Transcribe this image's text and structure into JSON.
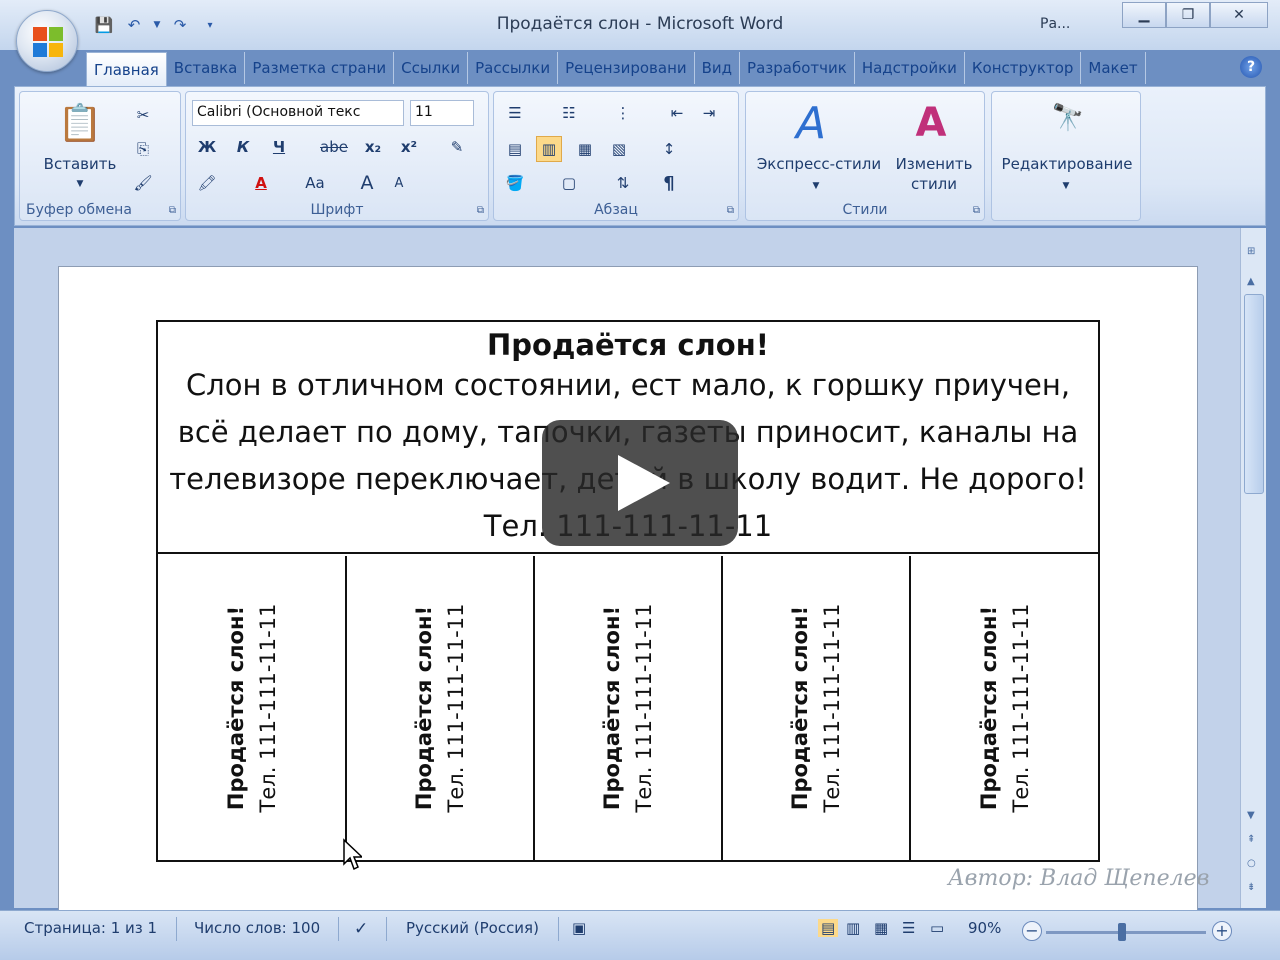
{
  "window": {
    "title": "Продаётся слон - Microsoft Word",
    "context": "Ра..."
  },
  "tabs": [
    "Главная",
    "Вставка",
    "Разметка страни",
    "Ссылки",
    "Рассылки",
    "Рецензировани",
    "Вид",
    "Разработчик",
    "Надстройки",
    "Конструктор",
    "Макет"
  ],
  "ribbon": {
    "clipboard": {
      "paste_label": "Вставить",
      "group_label": "Буфер обмена"
    },
    "font": {
      "font_name": "Calibri (Основной текс",
      "font_size": "11",
      "group_label": "Шрифт",
      "bold": "Ж",
      "italic": "К",
      "underline": "Ч",
      "strike": "abe",
      "subscript": "x₂",
      "superscript": "x²",
      "change_case": "Aa",
      "grow": "A",
      "shrink": "A"
    },
    "paragraph": {
      "group_label": "Абзац",
      "pilcrow": "¶"
    },
    "styles": {
      "quick_styles": "Экспресс-стили",
      "change_styles": "Изменить стили",
      "group_label": "Стили"
    },
    "editing": {
      "label": "Редактирование"
    }
  },
  "document": {
    "title": "Продаётся слон!",
    "body": "Слон в отличном состоянии, ест мало, к горшку приучен, всё делает по дому, тапочки, газеты приносит, каналы на телевизоре переключает, детей в школу водит. Не дорого! Тел. 111-111-11-11",
    "tear_offs": [
      {
        "line1": "Продаётся слон!",
        "line2": "Тел. 111-111-11-11"
      },
      {
        "line1": "Продаётся слон!",
        "line2": "Тел. 111-111-11-11"
      },
      {
        "line1": "Продаётся слон!",
        "line2": "Тел. 111-111-11-11"
      },
      {
        "line1": "Продаётся слон!",
        "line2": "Тел. 111-111-11-11"
      },
      {
        "line1": "Продаётся слон!",
        "line2": "Тел. 111-111-11-11"
      }
    ]
  },
  "watermark": "Автор: Влад Щепелев",
  "statusbar": {
    "page": "Страница: 1 из 1",
    "words": "Число слов: 100",
    "language": "Русский (Россия)",
    "zoom": "90%"
  },
  "colors": {
    "ribbon": "#dce7f6",
    "titlebar": "#c4d6ee",
    "doc_bg": "#c2d2ea"
  }
}
